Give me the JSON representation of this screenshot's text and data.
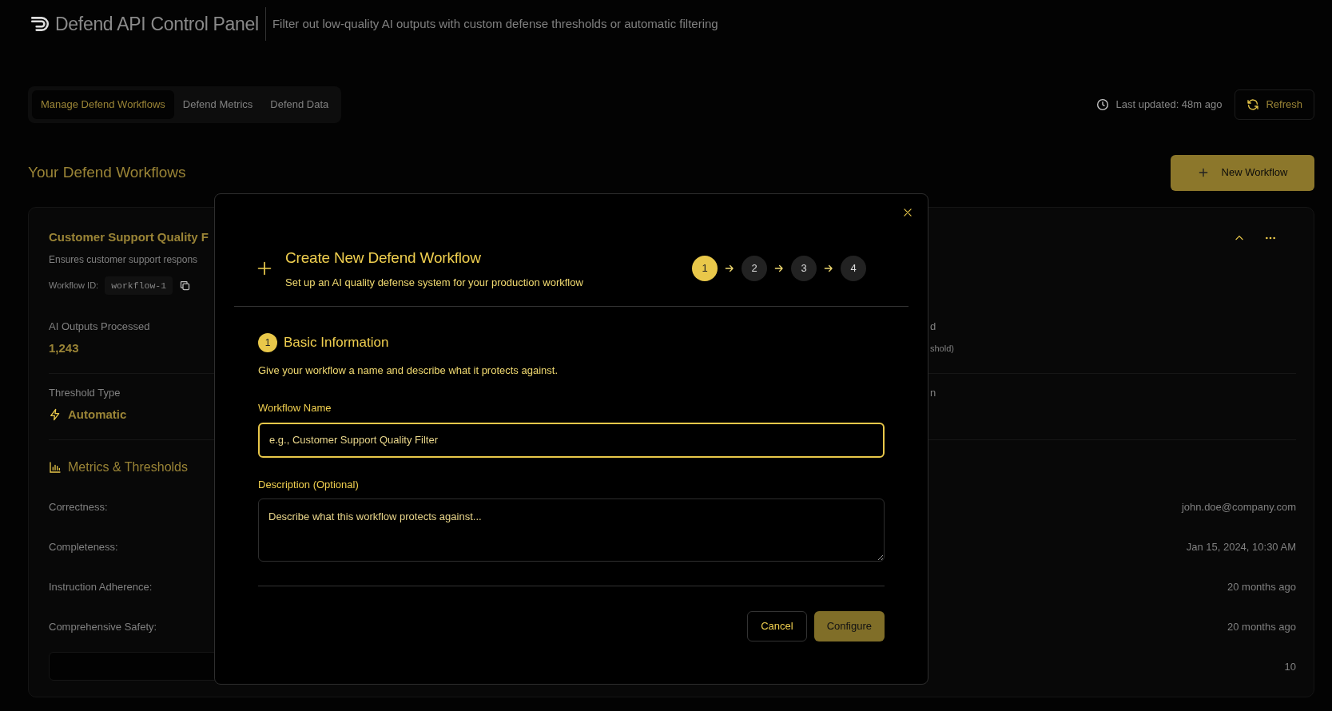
{
  "header": {
    "title": "Defend API Control Panel",
    "subtitle": "Filter out low-quality AI outputs with custom defense thresholds or automatic filtering"
  },
  "tabs": [
    {
      "label": "Manage Defend Workflows",
      "selected": true
    },
    {
      "label": "Defend Metrics",
      "selected": false
    },
    {
      "label": "Defend Data",
      "selected": false
    }
  ],
  "last_updated": "Last updated: 48m ago",
  "refresh_button": "Refresh",
  "section_title": "Your Defend Workflows",
  "new_workflow_button": "New Workflow",
  "workflow_card": {
    "title": "Customer Support Quality F",
    "description": "Ensures customer support respons",
    "id_label": "Workflow ID:",
    "id_value": "workflow-1",
    "expanded": true,
    "stats": [
      {
        "kind": "count",
        "label": "AI Outputs Processed",
        "value": "1,243",
        "column_2": {
          "label": "d",
          "value": "shold)"
        }
      },
      {
        "kind": "threshold",
        "label": "Threshold Type",
        "value": "Automatic",
        "column_2": {
          "label": "n"
        }
      }
    ],
    "metrics_title": "Metrics & Thresholds",
    "metrics": [
      {
        "kind": "row",
        "label": "Correctness:",
        "value": "john.doe@company.com"
      },
      {
        "kind": "row",
        "label": "Completeness:",
        "value": "Jan 15, 2024, 10:30 AM"
      },
      {
        "kind": "row",
        "label": "Instruction Adherence:",
        "value": "20 months ago"
      },
      {
        "kind": "row",
        "label": "Comprehensive Safety:",
        "value": "20 months ago"
      },
      {
        "kind": "box",
        "value": "10"
      }
    ]
  },
  "modal": {
    "title": "Create New Defend Workflow",
    "subtitle": "Set up an AI quality defense system for your production workflow",
    "steps": [
      {
        "label": "1",
        "selected": true
      },
      {
        "label": "2",
        "selected": false
      },
      {
        "label": "3",
        "selected": false
      },
      {
        "label": "4",
        "selected": false
      }
    ],
    "section": {
      "number": "1",
      "title": "Basic Information",
      "description": "Give your workflow a name and describe what it protects against."
    },
    "fields": [
      {
        "kind": "input",
        "label": "Workflow Name",
        "placeholder": "e.g., Customer Support Quality Filter",
        "focused": true
      },
      {
        "kind": "textarea",
        "label": "Description (Optional)",
        "placeholder": "Describe what this workflow protects against...",
        "focused": false
      }
    ],
    "buttons": [
      {
        "kind": "secondary",
        "label": "Cancel",
        "disabled": false
      },
      {
        "kind": "primary",
        "label": "Configure",
        "disabled": true
      }
    ]
  }
}
